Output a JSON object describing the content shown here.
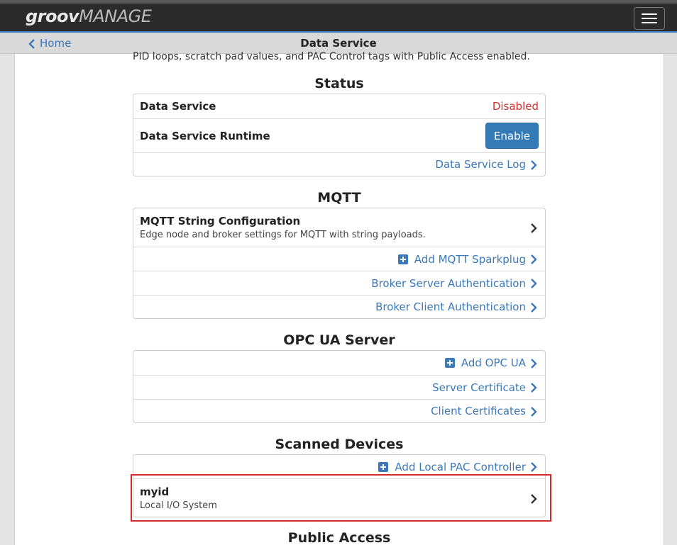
{
  "header": {
    "logo_bold": "groov",
    "logo_light": "MANAGE",
    "menu_icon": "hamburger-icon"
  },
  "navbar": {
    "home_label": "Home",
    "title": "Data Service"
  },
  "intro_text": "PID loops, scratch pad values, and PAC Control tags with Public Access enabled.",
  "status": {
    "title": "Status",
    "data_service_label": "Data Service",
    "data_service_value": "Disabled",
    "runtime_label": "Data Service Runtime",
    "enable_label": "Enable",
    "log_link": "Data Service Log"
  },
  "mqtt": {
    "title": "MQTT",
    "config_title": "MQTT String Configuration",
    "config_desc": "Edge node and broker settings for MQTT with string payloads.",
    "add_sparkplug": "Add MQTT Sparkplug",
    "broker_server_auth": "Broker Server Authentication",
    "broker_client_auth": "Broker Client Authentication"
  },
  "opcua": {
    "title": "OPC UA Server",
    "add_opcua": "Add OPC UA",
    "server_cert": "Server Certificate",
    "client_certs": "Client Certificates"
  },
  "scanned": {
    "title": "Scanned Devices",
    "add_local_pac": "Add Local PAC Controller",
    "device_name": "myid",
    "device_desc": "Local I/O System"
  },
  "public_access": {
    "title": "Public Access"
  },
  "colors": {
    "accent": "#3b78b9",
    "disabled": "#d1312f",
    "button": "#337ab7",
    "highlight": "#d42a2a"
  }
}
